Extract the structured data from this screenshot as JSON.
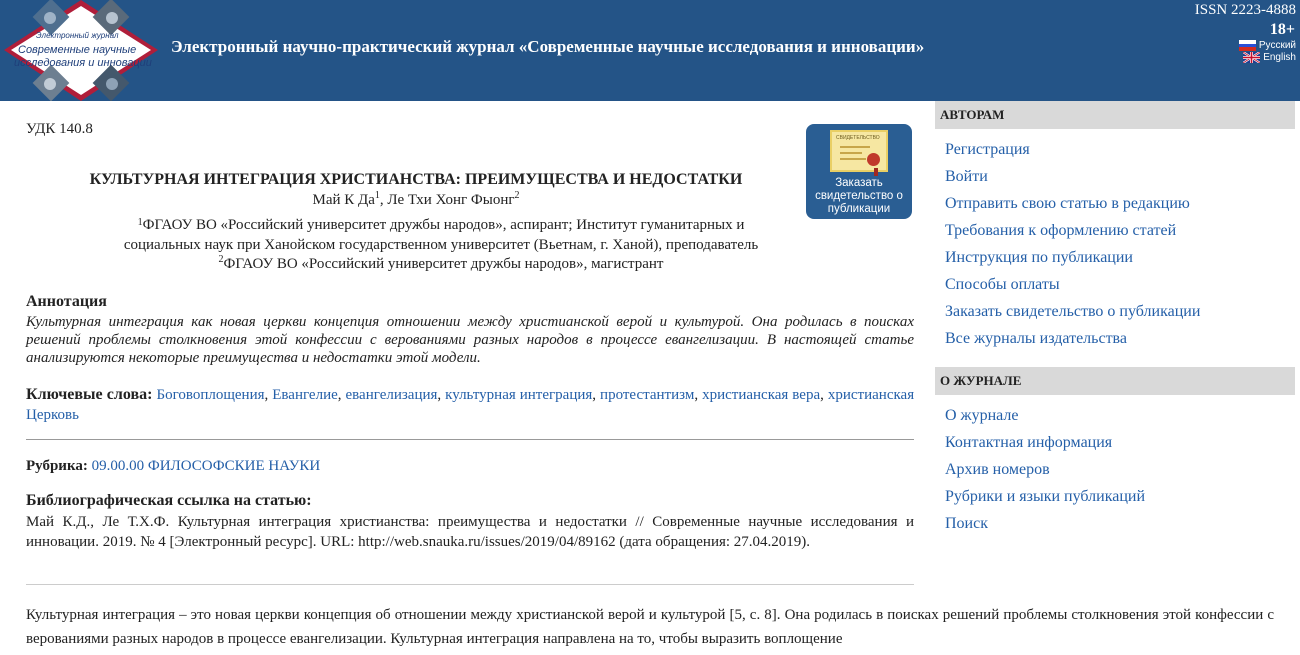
{
  "header": {
    "logo_text": [
      "Электронный журнал",
      "Современные научные",
      "исследования и инновации"
    ],
    "site_title": "Электронный научно-практический журнал «Современные научные исследования и инновации»",
    "issn": "ISSN 2223-4888",
    "age_rating": "18+",
    "lang_ru": "Русский",
    "lang_en": "English"
  },
  "article": {
    "udk": "УДК 140.8",
    "order_badge_text": "Заказать свидетельство о публикации",
    "order_badge_cert_label": "СВИДЕТЕЛЬСТВО",
    "title": "КУЛЬТУРНАЯ ИНТЕГРАЦИЯ ХРИСТИАНСТВА: ПРЕИМУЩЕСТВА И НЕДОСТАТКИ",
    "author1": "Май К Да",
    "author_sep": ", ",
    "author2": "Ле Тхи Хонг Фыонг",
    "sup1": "1",
    "sup2": "2",
    "affiliation1_line1": "ФГАОУ ВО «Российский университет дружбы народов», аспирант; Институт гуманитарных и",
    "affiliation1_line2": "социальных наук при Ханойском государственном университет (Вьетнам, г. Ханой), преподаватель",
    "affiliation2": "ФГАОУ ВО «Российский университет дружбы народов», магистрант",
    "annotation_heading": "Аннотация",
    "annotation_text": "Культурная интеграция как новая церкви концепция отношении между христианской верой и культурой. Она родилась в поисках решений проблемы столкновения этой конфессии с верованиями разных народов в процессе евангелизации. В настоящей статье анализируются некоторые преимущества и недостатки этой модели.",
    "keywords_label": "Ключевые слова:",
    "keywords": [
      "Боговоплощения",
      "Евангелие",
      "евангелизация",
      "культурная интеграция",
      "протестантизм",
      "христианская вера",
      "христианская Церковь"
    ],
    "rubric_label": "Рубрика:",
    "rubric_value": "09.00.00 ФИЛОСОФСКИЕ НАУКИ",
    "biblio_heading": "Библиографическая ссылка на статью:",
    "biblio_text": "Май К.Д., Ле Т.Х.Ф. Культурная интеграция христианства: преимущества и недостатки // Современные научные исследования и инновации. 2019. № 4 [Электронный ресурс]. URL: http://web.snauka.ru/issues/2019/04/89162 (дата обращения: 27.04.2019).",
    "body_text": "Культурная интеграция – это новая церкви концепция об отношении между христианской верой и культурой [5, с. 8]. Она родилась в поисках решений проблемы столкновения этой конфессии с верованиями разных народов в процессе евангелизации. Культурная интеграция направлена на то, чтобы выразить воплощение"
  },
  "sidebar": {
    "authors_heading": "АВТОРАМ",
    "authors_items": [
      "Регистрация",
      "Войти",
      "Отправить свою статью в редакцию",
      "Требования к оформлению статей",
      "Инструкция по публикации",
      "Способы оплаты",
      "Заказать свидетельство о публикации",
      "Все журналы издательства"
    ],
    "journal_heading": "О ЖУРНАЛЕ",
    "journal_items": [
      "О журнале",
      "Контактная информация",
      "Архив номеров",
      "Рубрики и языки публикаций",
      "Поиск"
    ]
  },
  "colors": {
    "header_bg": "#245487",
    "link": "#245fa8",
    "sidebar_head_bg": "#d9d9d9"
  }
}
